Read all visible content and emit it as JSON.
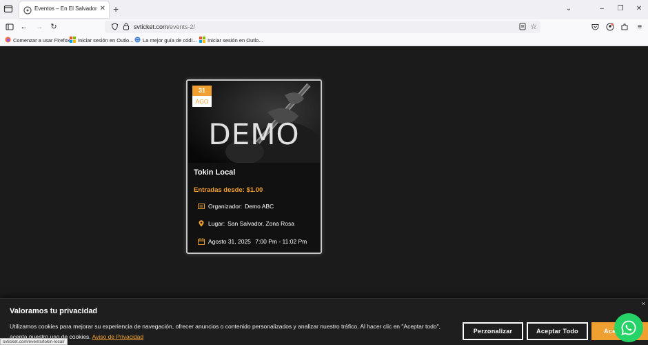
{
  "browser": {
    "tab_title": "Eventos – En El Salvador C.A. – S",
    "url_domain": "svticket.com",
    "url_path": "/events-2/",
    "bookmarks": [
      "Comenzar a usar Firefox",
      "Iniciar sesión en Outlo...",
      "La mejor guía de códi...",
      "Iniciar sesión en Outlo..."
    ]
  },
  "event": {
    "date_day": "31",
    "date_month": "AGO",
    "image_text": "DEMO",
    "title": "Tokin Local",
    "price": "Entradas desde: $1.00",
    "organizer_label": "Organizador:",
    "organizer_value": "Demo ABC",
    "location_label": "Lugar:",
    "location_value": "San Salvador, Zona Rosa",
    "date_text": "Agosto 31, 2025",
    "time_text": "7:00 Pm - 11:02 Pm"
  },
  "cookie_banner": {
    "title": "Valoramos tu privacidad",
    "text": "Utilizamos cookies para mejorar su experiencia de navegación, ofrecer anuncios o contenido personalizados y analizar nuestro tráfico. Al hacer clic en \"Aceptar todo\", acepta nuestro uso de cookies.",
    "link": "Aviso de Privacidad",
    "customize_label": "Perzonalizar",
    "accept_all_label": "Aceptar Todo",
    "accept_label": "Ace",
    "close_label": "×"
  },
  "status_bar_url": "svticket.com/events/tokin-local/",
  "colors": {
    "accent": "#f0a030",
    "page_background": "#1b1b1b",
    "whatsapp": "#25d366"
  },
  "icons": [
    "tab-list-icon",
    "firefox-icon",
    "close-icon",
    "plus-icon",
    "chevron-down-icon",
    "minimize-icon",
    "restore-icon",
    "close-window-icon",
    "sidebar-icon",
    "back-icon",
    "forward-icon",
    "reload-icon",
    "shield-icon",
    "lock-icon",
    "reader-icon",
    "star-icon",
    "pocket-icon",
    "account-icon",
    "extensions-icon",
    "menu-icon",
    "calendar-icon",
    "map-pin-icon",
    "organizer-icon",
    "whatsapp-icon"
  ]
}
